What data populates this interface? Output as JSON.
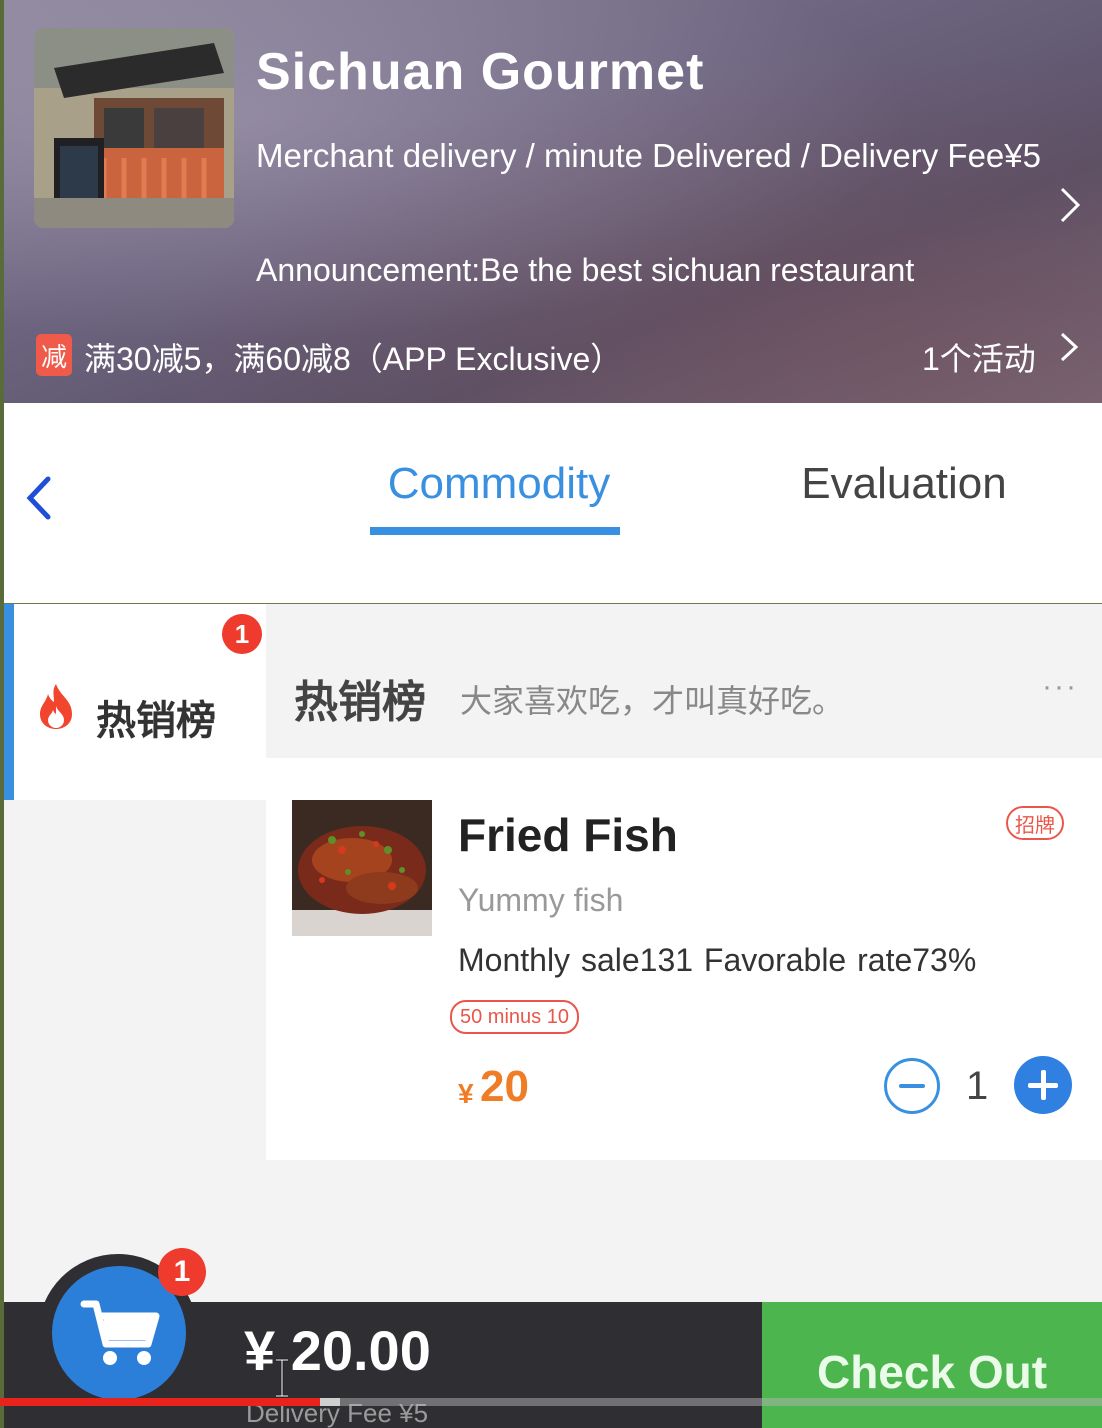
{
  "shop": {
    "name": "Sichuan Gourmet",
    "delivery_info": "Merchant delivery /  minute Delivered / Delivery Fee¥5",
    "announcement": "Announcement:Be the best sichuan restaurant",
    "promo_badge": "减",
    "promo_text": "满30减5，满60减8（APP Exclusive）",
    "activity_count": "1个活动"
  },
  "tabs": {
    "commodity": "Commodity",
    "evaluation": "Evaluation",
    "active": "Commodity"
  },
  "sidebar": {
    "items": [
      {
        "label": "热销榜",
        "badge": "1",
        "icon": "fire-icon"
      }
    ]
  },
  "section": {
    "title": "热销榜",
    "description": "大家喜欢吃，才叫真好吃。",
    "more": "···"
  },
  "product": {
    "name": "Fried Fish",
    "signature_tag": "招牌",
    "description": "Yummy fish",
    "stats": "Monthly sale131  Favorable rate73%",
    "discount_tag": "50 minus 10",
    "price_symbol": "¥",
    "price": "20",
    "quantity": "1"
  },
  "cart": {
    "badge": "1",
    "total": "¥ 20.00",
    "delivery_fee": "Delivery Fee ¥5",
    "checkout_label": "Check Out"
  },
  "video": {
    "progress": 0.29
  },
  "colors": {
    "accent": "#3a90e0",
    "price": "#f07c26",
    "badge": "#ee3b2e",
    "checkout": "#4cb54e",
    "cart_bar": "#2f2f33"
  }
}
